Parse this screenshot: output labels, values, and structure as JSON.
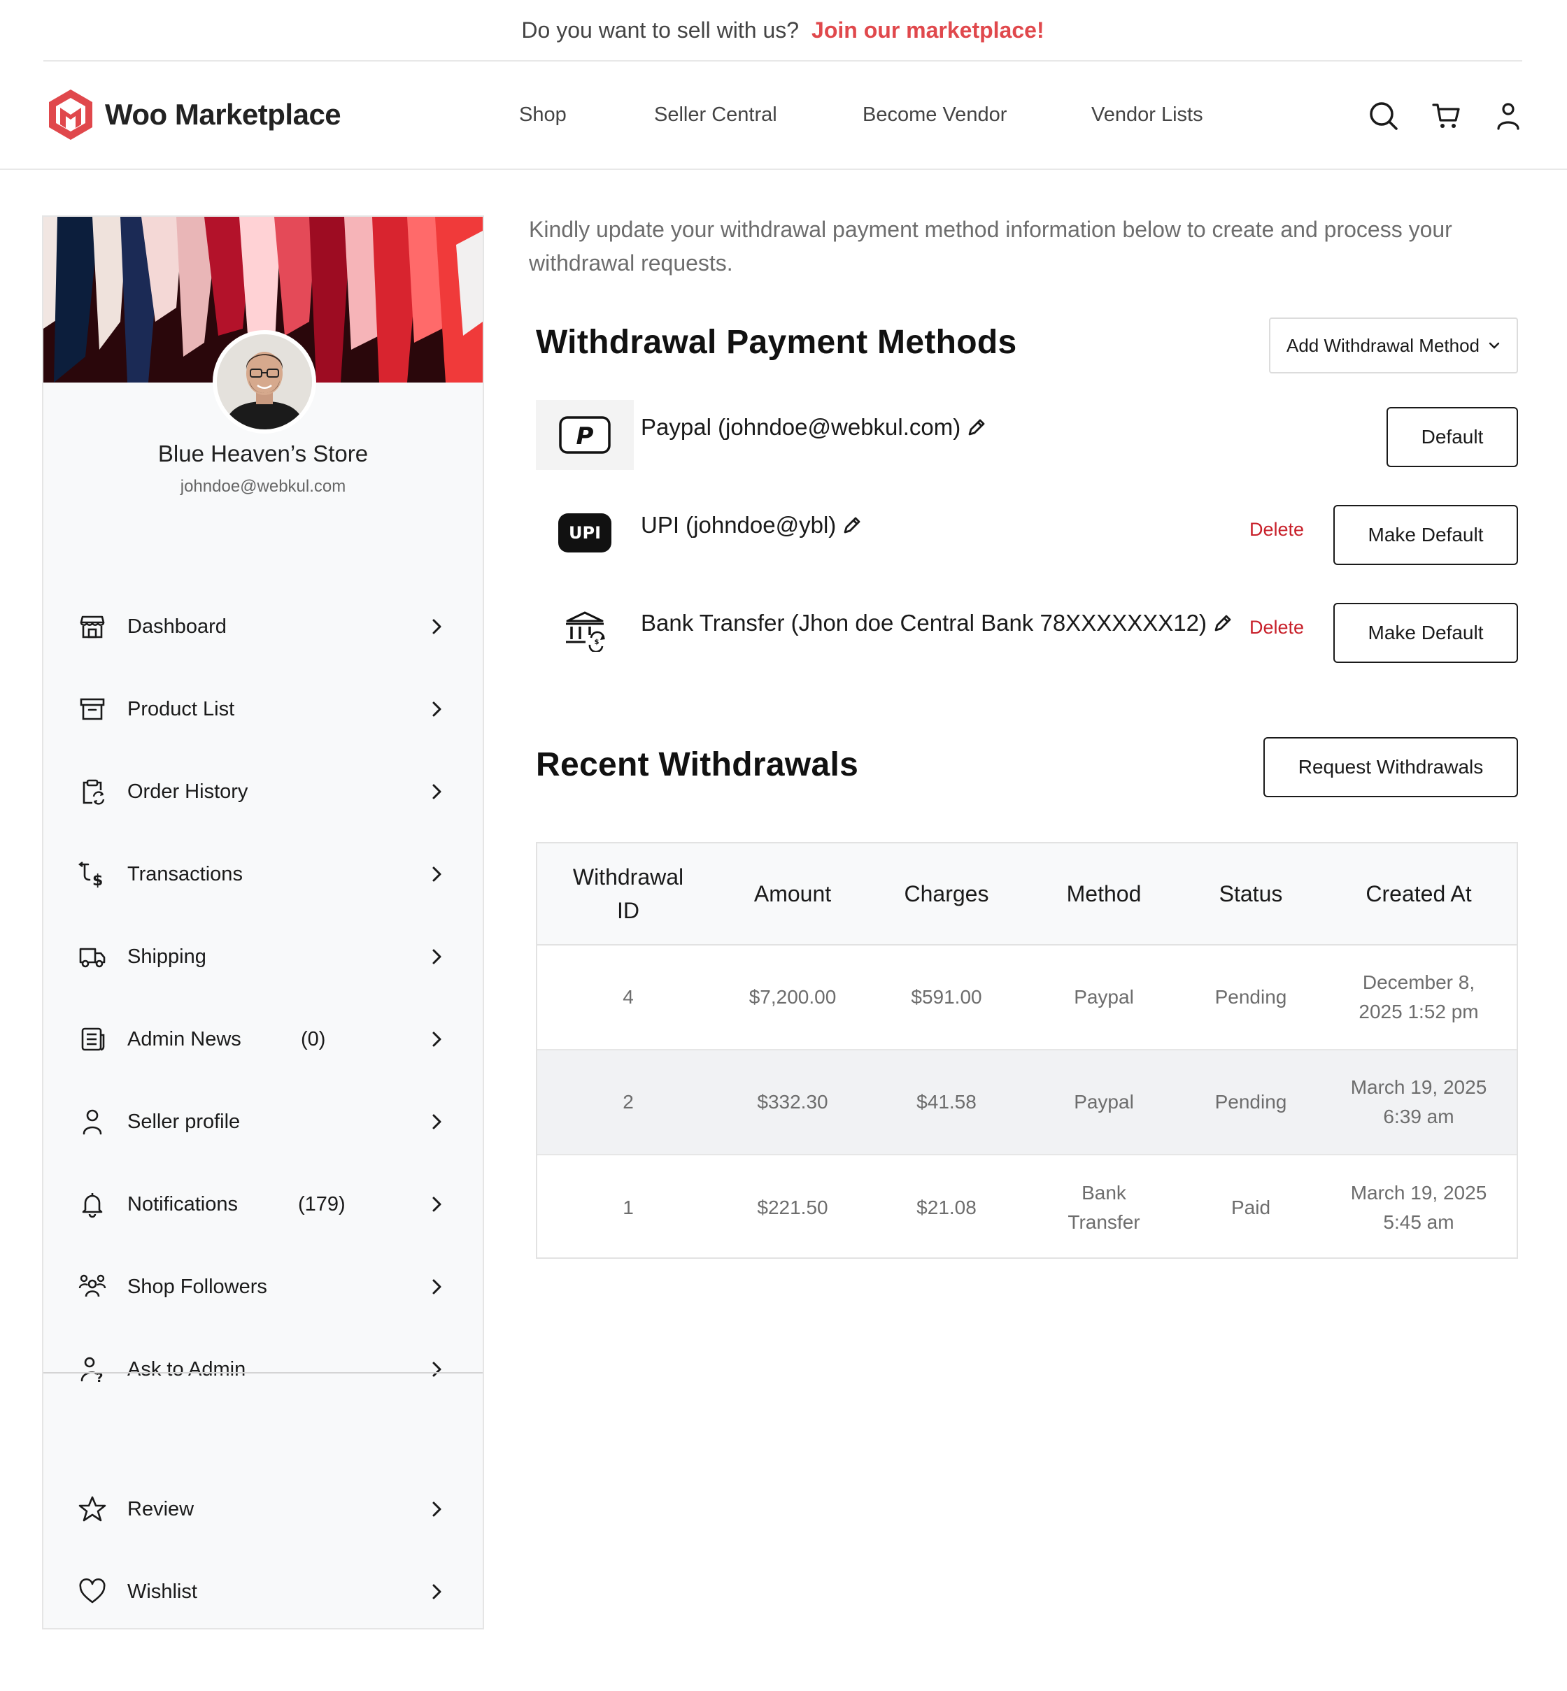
{
  "promo": {
    "text": "Do you want to sell with us?",
    "cta": "Join our marketplace!"
  },
  "header": {
    "brand": "Woo Marketplace",
    "nav": [
      "Shop",
      "Seller Central",
      "Become Vendor",
      "Vendor Lists"
    ],
    "icons": [
      "search-icon",
      "cart-icon",
      "user-icon"
    ]
  },
  "sidebar": {
    "store_name": "Blue Heaven’s Store",
    "store_email": "johndoe@webkul.com",
    "items": [
      {
        "label": "Dashboard",
        "count": "",
        "icon": "store-icon"
      },
      {
        "label": "Product List",
        "count": "",
        "icon": "archive-icon"
      },
      {
        "label": "Order History",
        "count": "",
        "icon": "clipboard-refresh-icon"
      },
      {
        "label": "Transactions",
        "count": "",
        "icon": "transaction-icon"
      },
      {
        "label": "Shipping",
        "count": "",
        "icon": "truck-icon"
      },
      {
        "label": "Admin News",
        "count": "(0)",
        "icon": "news-icon"
      },
      {
        "label": "Seller profile",
        "count": "",
        "icon": "user-icon"
      },
      {
        "label": "Notifications",
        "count": "(179)",
        "icon": "bell-icon"
      },
      {
        "label": "Shop Followers",
        "count": "",
        "icon": "users-group-icon"
      },
      {
        "label": "Ask to Admin",
        "count": "",
        "icon": "user-question-icon"
      }
    ],
    "extra_items": [
      {
        "label": "Review",
        "icon": "star-icon"
      },
      {
        "label": "Wishlist",
        "icon": "heart-icon"
      }
    ]
  },
  "main": {
    "intro": "Kindly update your withdrawal payment method information below to create and process your withdrawal requests.",
    "methods_title": "Withdrawal Payment Methods",
    "add_method_label": "Add Withdrawal Method",
    "methods": [
      {
        "name": "Paypal (johndoe@webkul.com)",
        "action": "Default",
        "delete": "",
        "logo": "paypal-logo"
      },
      {
        "name": "UPI (johndoe@ybl)",
        "action": "Make Default",
        "delete": "Delete",
        "logo": "upi-logo"
      },
      {
        "name": "Bank Transfer (Jhon doe Central Bank 78XXXXXXX12)",
        "action": "Make Default",
        "delete": "Delete",
        "logo": "bank-logo"
      }
    ],
    "withdrawals_title": "Recent Withdrawals",
    "request_label": "Request Withdrawals",
    "table": {
      "headers": [
        "Withdrawal ID",
        "Amount",
        "Charges",
        "Method",
        "Status",
        "Created At"
      ],
      "rows": [
        [
          "4",
          "$7,200.00",
          "$591.00",
          "Paypal",
          "Pending",
          "December 8, 2025 1:52 pm"
        ],
        [
          "2",
          "$332.30",
          "$41.58",
          "Paypal",
          "Pending",
          "March 19, 2025 6:39 am"
        ],
        [
          "1",
          "$221.50",
          "$21.08",
          "Bank Transfer",
          "Paid",
          "March 19, 2025 5:45 am"
        ]
      ]
    }
  },
  "colors": {
    "accent": "#e0484c",
    "delete": "#c8202a",
    "text_muted": "#6d6d6d",
    "panel_bg": "#f8f9fa"
  }
}
